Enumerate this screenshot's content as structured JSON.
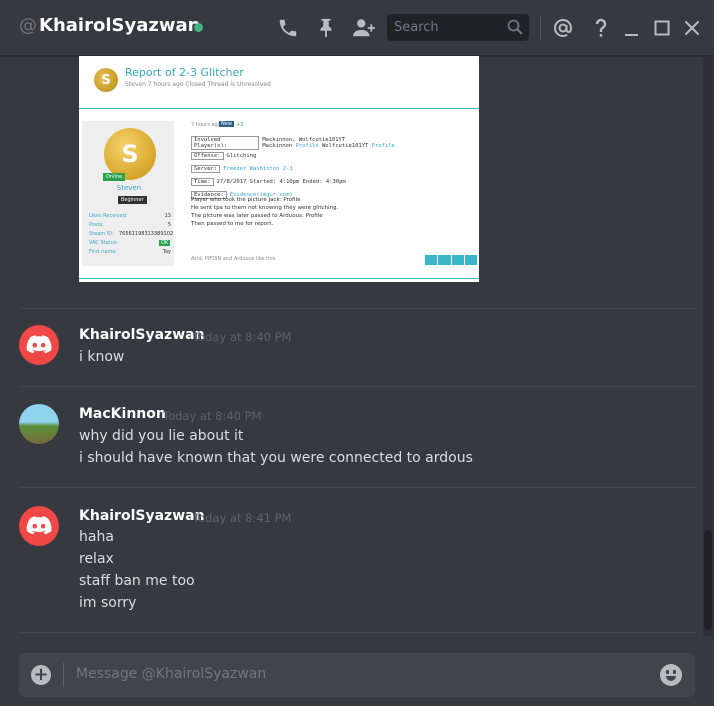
{
  "header": {
    "at_symbol": "@",
    "username": "KhairolSyazwan",
    "status_color": "#43b581",
    "search_placeholder": "Search",
    "icons": [
      "phone-icon",
      "pin-icon",
      "add-friend-icon",
      "search-icon",
      "mention-icon",
      "help-icon",
      "minimize-icon",
      "maximize-icon",
      "close-icon"
    ]
  },
  "embed": {
    "logo_letter": "S",
    "title": "Report of 2-3 Glitcher",
    "meta": "Steven   7 hours ago   Closed   Thread is Unresolved",
    "online": "Online",
    "user": "Steven",
    "rank": "Beginner",
    "stats": [
      {
        "label": "Likes Received:",
        "value": "13"
      },
      {
        "label": "Posts:",
        "value": "5"
      },
      {
        "label": "Steam ID:",
        "value": "76561198313389102"
      },
      {
        "label": "VAC Status:",
        "value": ""
      },
      {
        "label": "First name:",
        "value": "Tay"
      }
    ],
    "vac_ok": "OK",
    "post_time": "7 hours ago",
    "post_new": "New",
    "post_likes": "+3",
    "fields": [
      {
        "label": "Involved Player(s):",
        "value": "Mackinnon, Wolfcutie101YT Mackinnon",
        "link": "Profile",
        "extra": "Wolfcutie101YT",
        "link2": "Profile"
      },
      {
        "label": "Offense:",
        "value": "Glitching",
        "link": "",
        "extra": "",
        "link2": ""
      },
      {
        "label": "Server:",
        "value": "",
        "link": "Freezer Washinton 2-3",
        "extra": "",
        "link2": ""
      },
      {
        "label": "Time:",
        "value": "27/8/2017 Started: 4:10pm Ended: 4:30pm",
        "link": "",
        "extra": "",
        "link2": ""
      },
      {
        "label": "Evidence:",
        "value": "",
        "link": "Evidence(imgur.com)",
        "extra": "",
        "link2": ""
      }
    ],
    "body_lines": [
      "Player who took the picture Jack: Profile",
      "He sent tpa to them not knowing they were glitching.",
      "The picture was later passed to Arduous: Profile",
      "Then passed to me for report."
    ],
    "liked_by": "Acid, PIFDIN and Arduous like this."
  },
  "messages": [
    {
      "author": "KhairolSyazwan",
      "time": "Today at 8:40 PM",
      "lines": [
        "i know"
      ]
    },
    {
      "author": "MacKinnon",
      "time": "Today at 8:40 PM",
      "lines": [
        "why did you lie about it",
        "i should have known that you were connected to ardous"
      ]
    },
    {
      "author": "KhairolSyazwan",
      "time": "Today at 8:41 PM",
      "lines": [
        "haha",
        "relax",
        "staff ban me too",
        "im sorry"
      ]
    }
  ],
  "composer": {
    "placeholder": "Message @KhairolSyazwan"
  }
}
